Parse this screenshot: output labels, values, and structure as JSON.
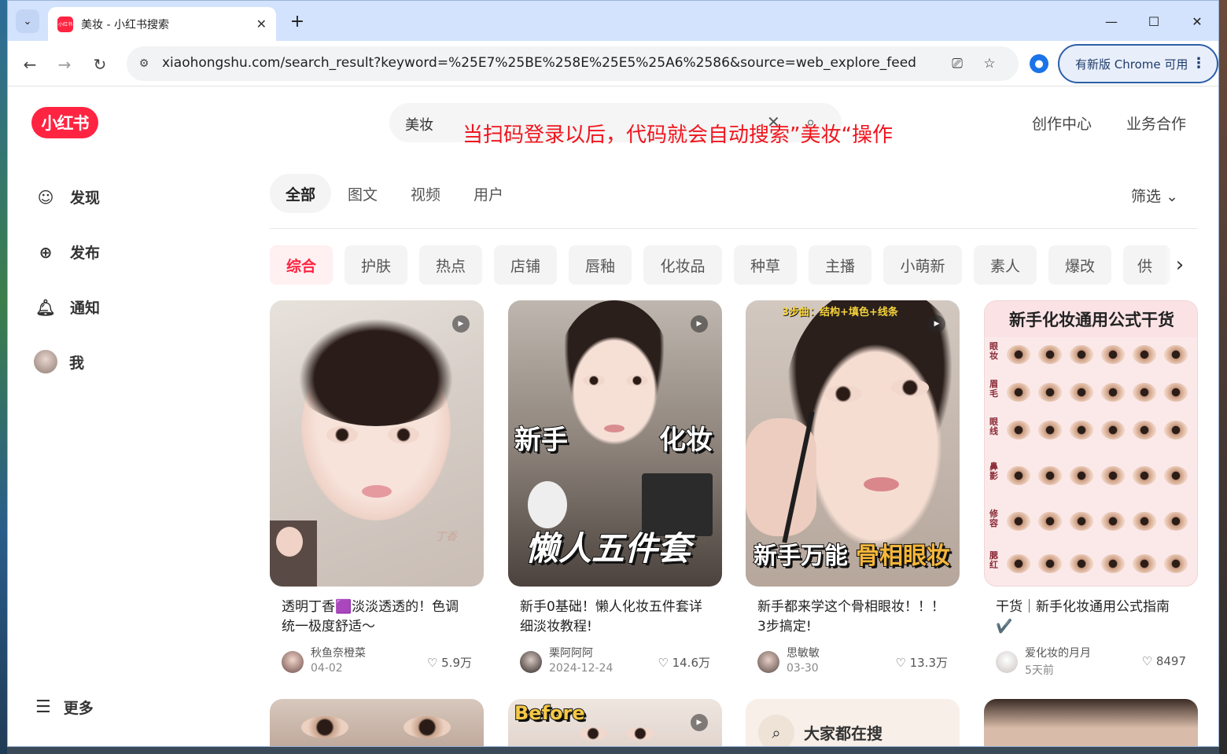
{
  "browser": {
    "tab_title": "美妆 - 小红书搜索",
    "favicon_text": "小红书",
    "url": "xiaohongshu.com/search_result?keyword=%25E7%25BE%258E%25E5%25A6%2586&source=web_explore_feed",
    "update_button": "有新版 Chrome 可用"
  },
  "site": {
    "logo": "小红书",
    "sidebar": [
      {
        "label": "发现",
        "icon": "discover-icon"
      },
      {
        "label": "发布",
        "icon": "plus-square-icon"
      },
      {
        "label": "通知",
        "icon": "bell-icon"
      },
      {
        "label": "我",
        "icon": "avatar"
      }
    ],
    "more_label": "更多",
    "search_query": "美妆",
    "annotation": "当扫码登录以后，代码就会自动搜索”美妆“操作",
    "top_links": [
      "创作中心",
      "业务合作"
    ],
    "tabs": [
      "全部",
      "图文",
      "视频",
      "用户"
    ],
    "active_tab": "全部",
    "filter_label": "筛选",
    "chips": [
      "综合",
      "护肤",
      "热点",
      "店铺",
      "唇釉",
      "化妆品",
      "种草",
      "主播",
      "小萌新",
      "素人",
      "爆改",
      "供"
    ],
    "active_chip": "综合",
    "cards": [
      {
        "title": "透明丁香🟪淡淡透透的！色调统一极度舒适～",
        "author": "秋鱼奈橙菜",
        "date": "04-02",
        "likes": "5.9万",
        "video": true,
        "overlay": "",
        "signature": "丁香"
      },
      {
        "title": "新手0基础！懒人化妆五件套详细淡妆教程!",
        "author": "栗阿阿阿",
        "date": "2024-12-24",
        "likes": "14.6万",
        "video": true,
        "overlay_a": "新手",
        "overlay_b": "化妆",
        "overlay_c": "懒人五件套"
      },
      {
        "title": "新手都来学这个骨相眼妆！！！3步搞定!",
        "author": "思敏敏",
        "date": "03-30",
        "likes": "13.3万",
        "video": true,
        "top_banner": "3步曲：结构+填色+线条",
        "overlay_a": "新手万能",
        "overlay_b": "骨相眼妆"
      },
      {
        "title": "干货｜新手化妆通用公式指南✔️",
        "author": "爱化妆的月月",
        "date": "5天前",
        "likes": "8497",
        "video": false,
        "banner": "新手化妆通用公式干货",
        "rows": [
          "眼妆",
          "眉毛",
          "眼线",
          "鼻影",
          "修容",
          "腮红"
        ]
      }
    ],
    "row2": {
      "before_label": "Before",
      "hot_search": "大家都在搜"
    }
  },
  "colors": {
    "brand": "#ff2442",
    "annotation": "#f0151e"
  }
}
